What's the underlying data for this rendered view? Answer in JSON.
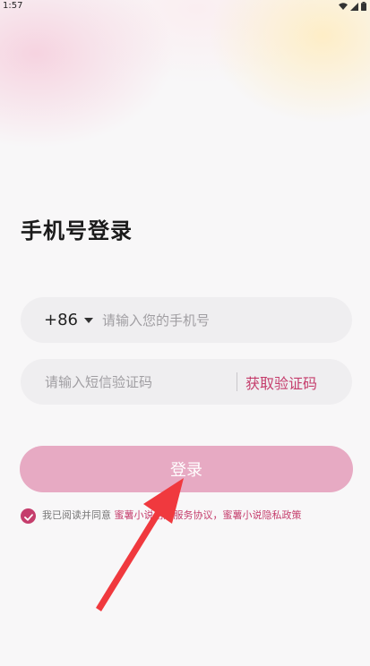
{
  "status_bar": {
    "time": "1:57"
  },
  "page": {
    "title": "手机号登录"
  },
  "phone_field": {
    "country_code": "+86",
    "value": "",
    "placeholder": "请输入您的手机号"
  },
  "code_field": {
    "value": "",
    "placeholder": "请输入短信验证码",
    "get_code_label": "获取验证码"
  },
  "login_button": {
    "label": "登录"
  },
  "agreement": {
    "checked": true,
    "prefix": "我已阅读并同意 ",
    "user_agreement": "蜜薯小说用户服务协议",
    "separator": "，",
    "privacy_policy": "蜜薯小说隐私政策"
  },
  "icons": {
    "wifi": "wifi-icon",
    "signal": "signal-icon",
    "battery": "battery-icon",
    "caret": "caret-down-icon",
    "check": "check-icon",
    "arrow": "red-arrow-annotation-icon"
  },
  "colors": {
    "accent": "#c53d6c",
    "login_button": "#e7aac3",
    "field_background": "#efeef0",
    "annotation_arrow": "#f0393e"
  }
}
